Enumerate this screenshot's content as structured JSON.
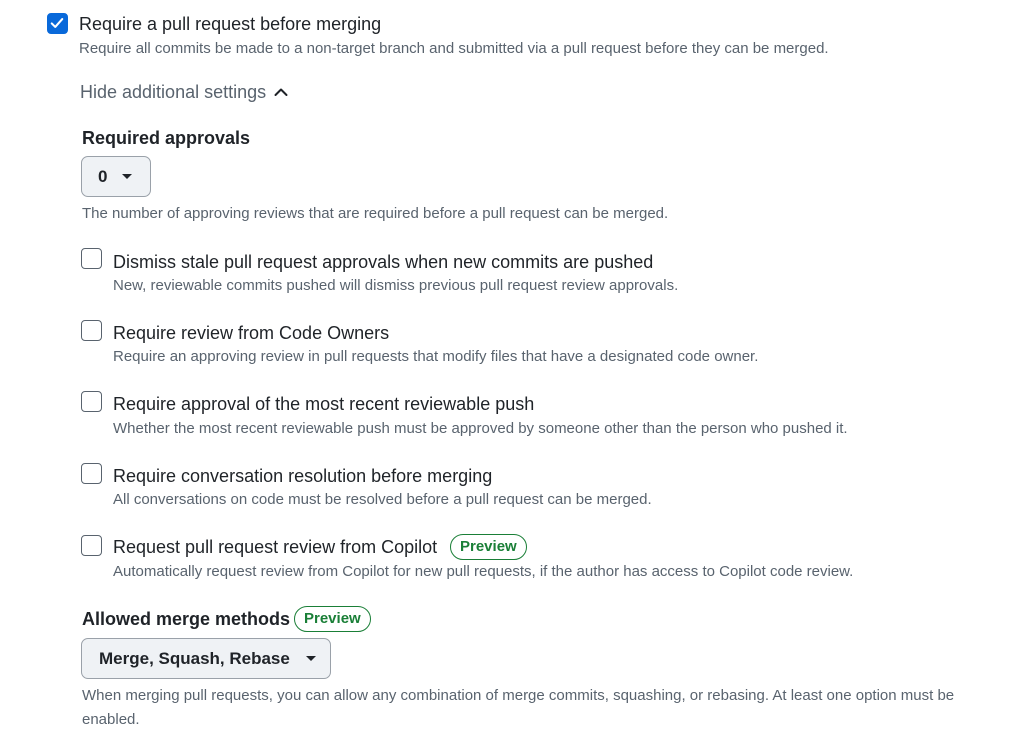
{
  "main_rule": {
    "title": "Require a pull request before merging",
    "description": "Require all commits be made to a non-target branch and submitted via a pull request before they can be merged.",
    "checked": true
  },
  "toggle": {
    "label": "Hide additional settings"
  },
  "required_approvals": {
    "heading": "Required approvals",
    "value": "0",
    "description": "The number of approving reviews that are required before a pull request can be merged."
  },
  "options": [
    {
      "title": "Dismiss stale pull request approvals when new commits are pushed",
      "description": "New, reviewable commits pushed will dismiss previous pull request review approvals.",
      "checked": false
    },
    {
      "title": "Require review from Code Owners",
      "description": "Require an approving review in pull requests that modify files that have a designated code owner.",
      "checked": false
    },
    {
      "title": "Require approval of the most recent reviewable push",
      "description": "Whether the most recent reviewable push must be approved by someone other than the person who pushed it.",
      "checked": false
    },
    {
      "title": "Require conversation resolution before merging",
      "description": "All conversations on code must be resolved before a pull request can be merged.",
      "checked": false
    },
    {
      "title": "Request pull request review from Copilot",
      "badge": "Preview",
      "description": "Automatically request review from Copilot for new pull requests, if the author has access to Copilot code review.",
      "checked": false
    }
  ],
  "merge_methods": {
    "heading": "Allowed merge methods",
    "badge": "Preview",
    "value": "Merge, Squash, Rebase",
    "description_line1": "When merging pull requests, you can allow any combination of merge commits, squashing, or rebasing. At least one option must be",
    "description_line2": "enabled."
  },
  "colors": {
    "accent": "#0969da",
    "muted_text": "#59636e",
    "badge_green": "#1a7f37"
  }
}
